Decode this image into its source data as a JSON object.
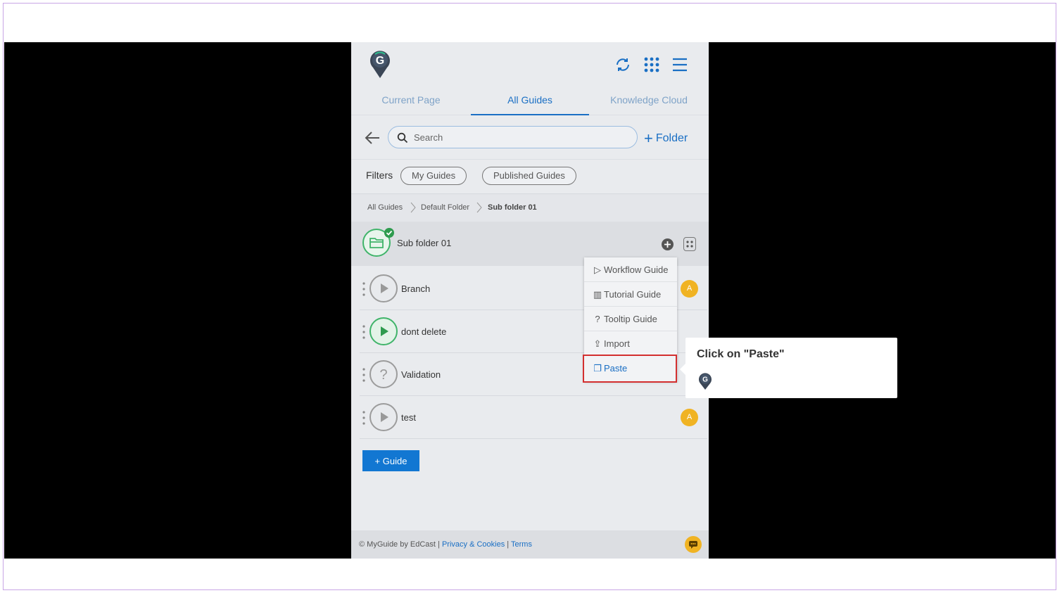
{
  "tabs": [
    {
      "label": "Current Page"
    },
    {
      "label": "All Guides"
    },
    {
      "label": "Knowledge Cloud"
    }
  ],
  "search": {
    "placeholder": "Search"
  },
  "toolbar": {
    "add_folder_label": "Folder"
  },
  "filters": {
    "label": "Filters",
    "chips": [
      {
        "label": "My Guides"
      },
      {
        "label": "Published Guides"
      }
    ]
  },
  "breadcrumb": [
    "All Guides",
    "Default Folder",
    "Sub folder 01"
  ],
  "folder": {
    "name": "Sub folder 01"
  },
  "guides": [
    {
      "name": "Branch",
      "avatar": "A"
    },
    {
      "name": "dont delete",
      "avatar": ""
    },
    {
      "name": "Validation",
      "avatar": ""
    },
    {
      "name": "test",
      "avatar": "A"
    }
  ],
  "add_guide_label": "+ Guide",
  "menu": {
    "items": [
      {
        "label": "Workflow Guide",
        "icon": "play-outline-icon"
      },
      {
        "label": "Tutorial Guide",
        "icon": "book-icon"
      },
      {
        "label": "Tooltip Guide",
        "icon": "question-icon"
      },
      {
        "label": "Import",
        "icon": "upload-icon"
      },
      {
        "label": "Paste",
        "icon": "clipboard-icon"
      }
    ]
  },
  "callout": {
    "title": "Click on \"Paste\""
  },
  "footer": {
    "copyright": "© MyGuide by EdCast",
    "privacy": "Privacy & Cookies",
    "terms": "Terms",
    "separator": "|"
  },
  "colors": {
    "accent": "#1a6fc4",
    "primary_button": "#1277d2",
    "highlight": "#d32f2f",
    "avatar": "#f0b323",
    "success": "#40b46a"
  }
}
